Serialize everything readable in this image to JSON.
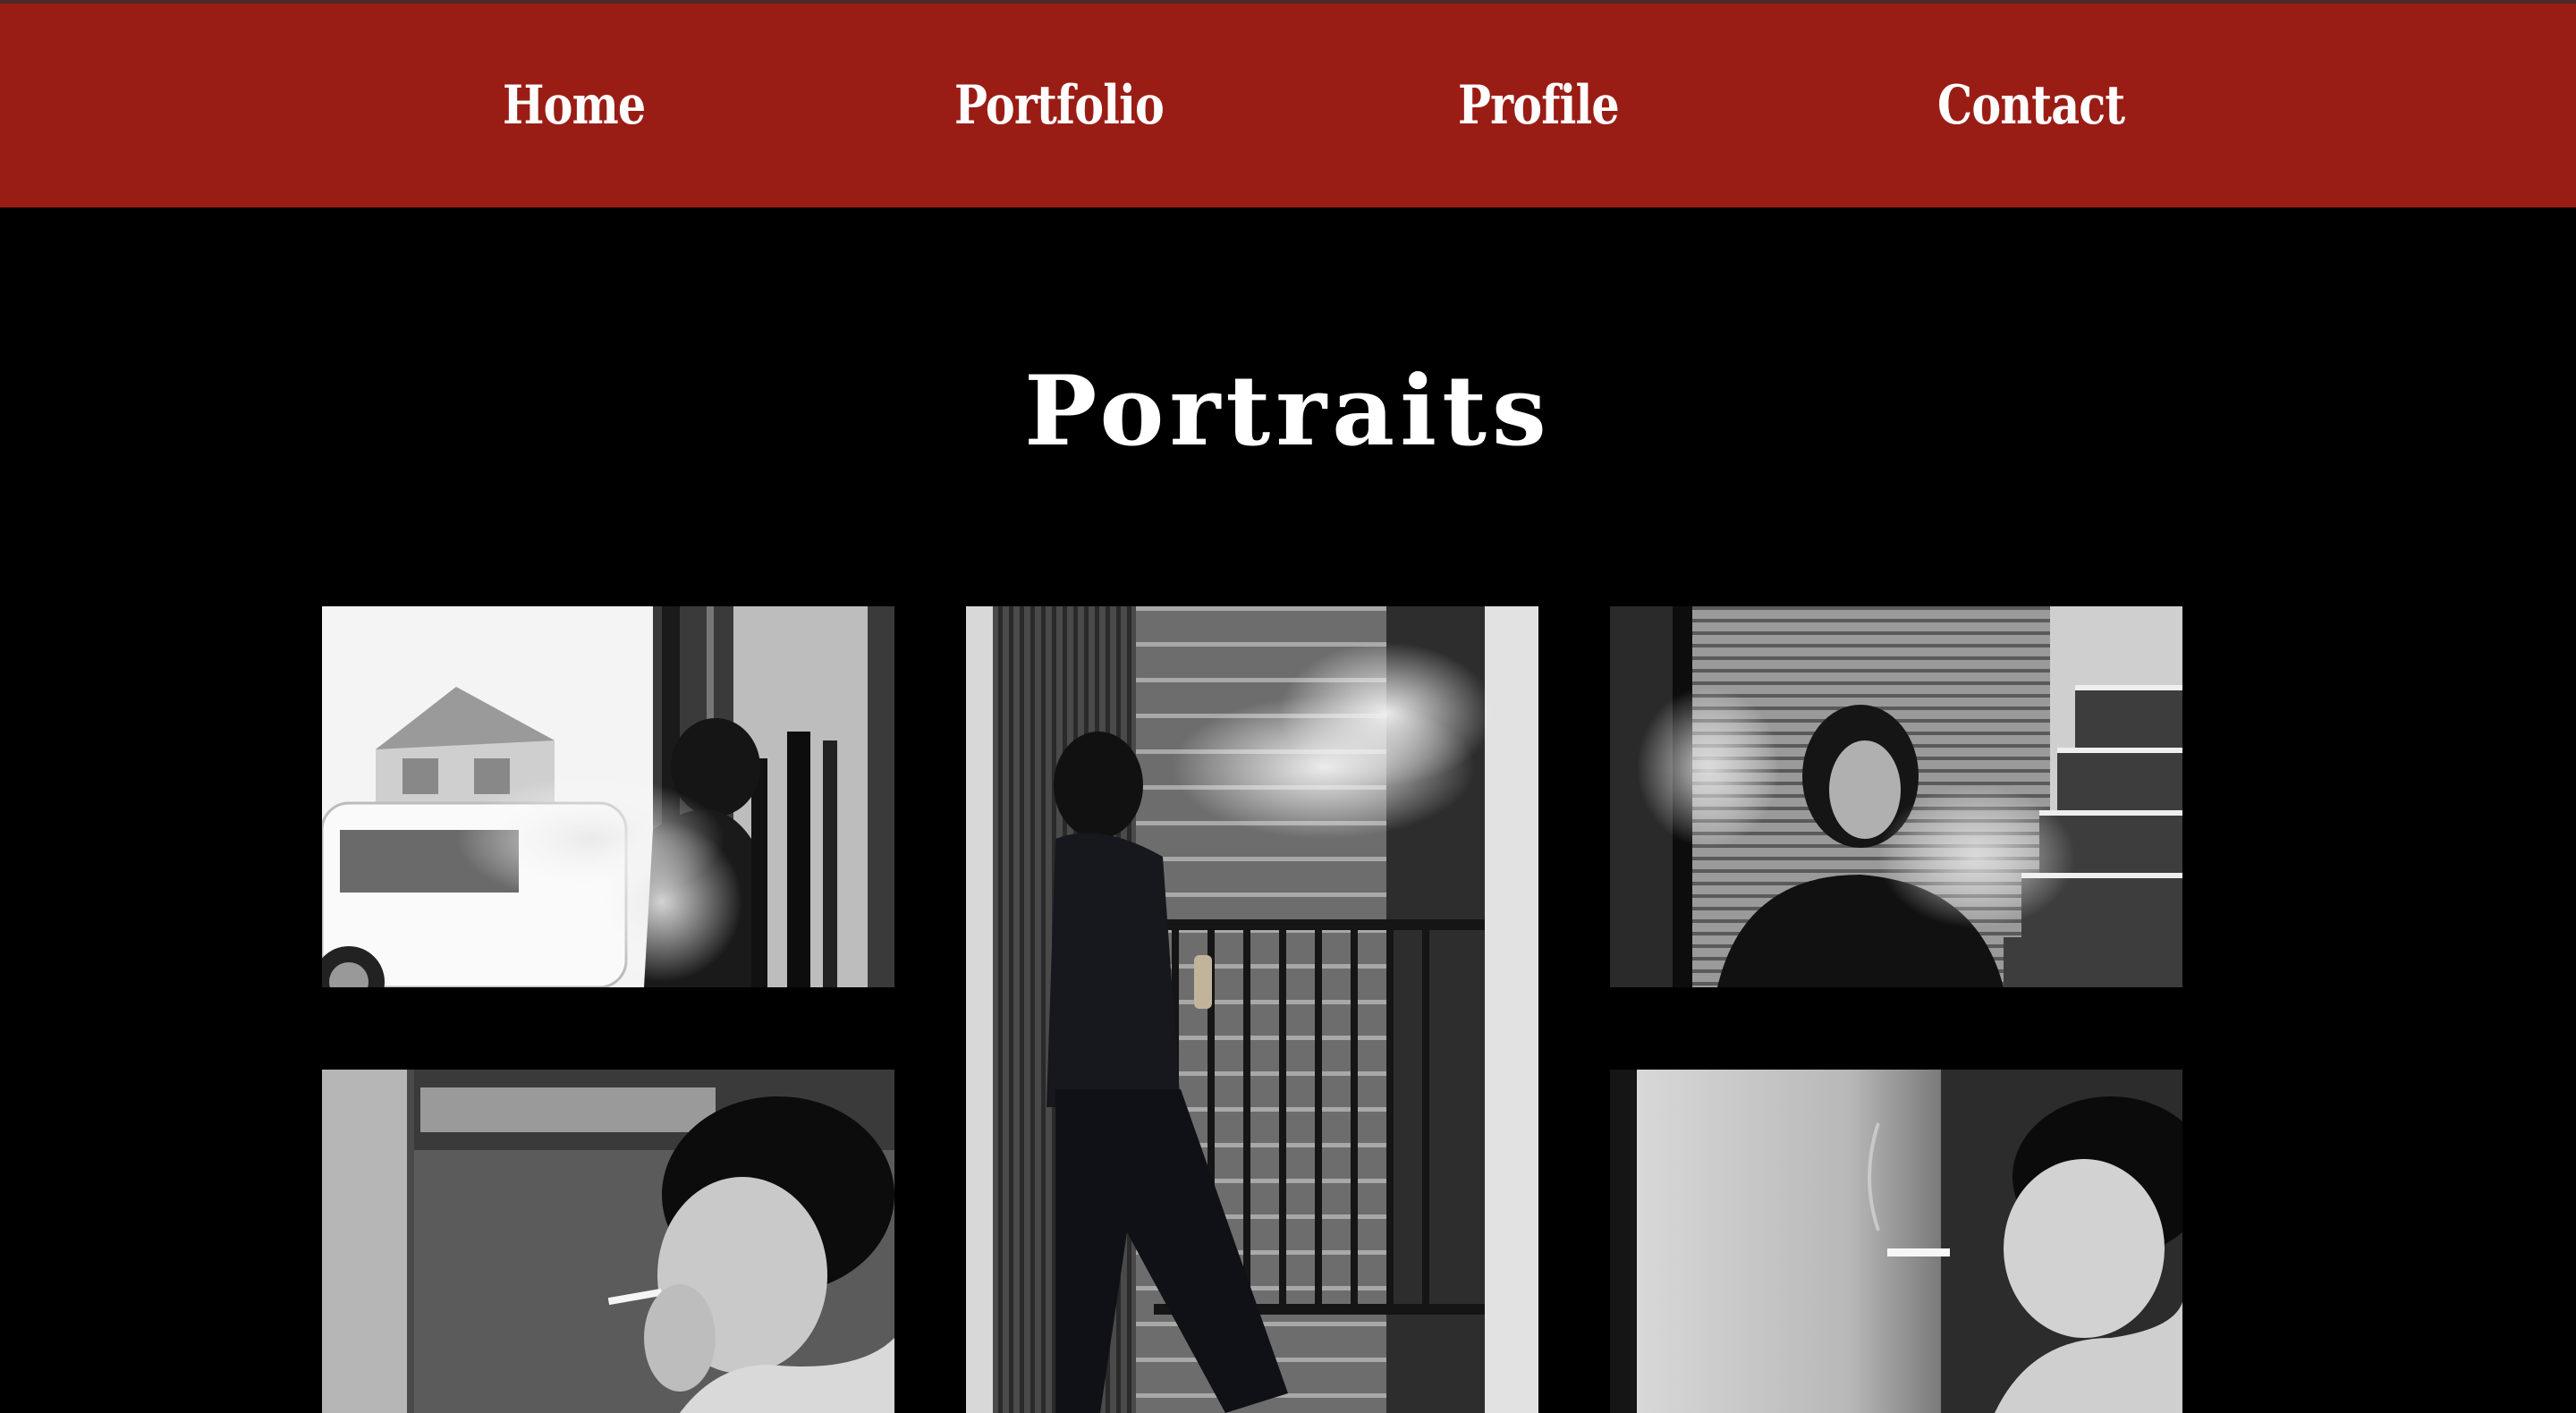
{
  "nav": {
    "home": "Home",
    "portfolio": "Portfolio",
    "profile": "Profile",
    "contact": "Contact"
  },
  "page": {
    "title": "Portraits"
  },
  "gallery": {
    "photos": [
      {
        "icon": "portrait-photo-smoke-window"
      },
      {
        "icon": "portrait-photo-stairs-smoke"
      },
      {
        "icon": "portrait-photo-smoke-stairs-wall"
      },
      {
        "icon": "portrait-photo-lighting-cigarette"
      },
      {
        "icon": "portrait-photo-smiling-cigarette"
      }
    ]
  },
  "colors": {
    "navbar": "#9a1d15",
    "background": "#000000",
    "text": "#ffffff"
  }
}
